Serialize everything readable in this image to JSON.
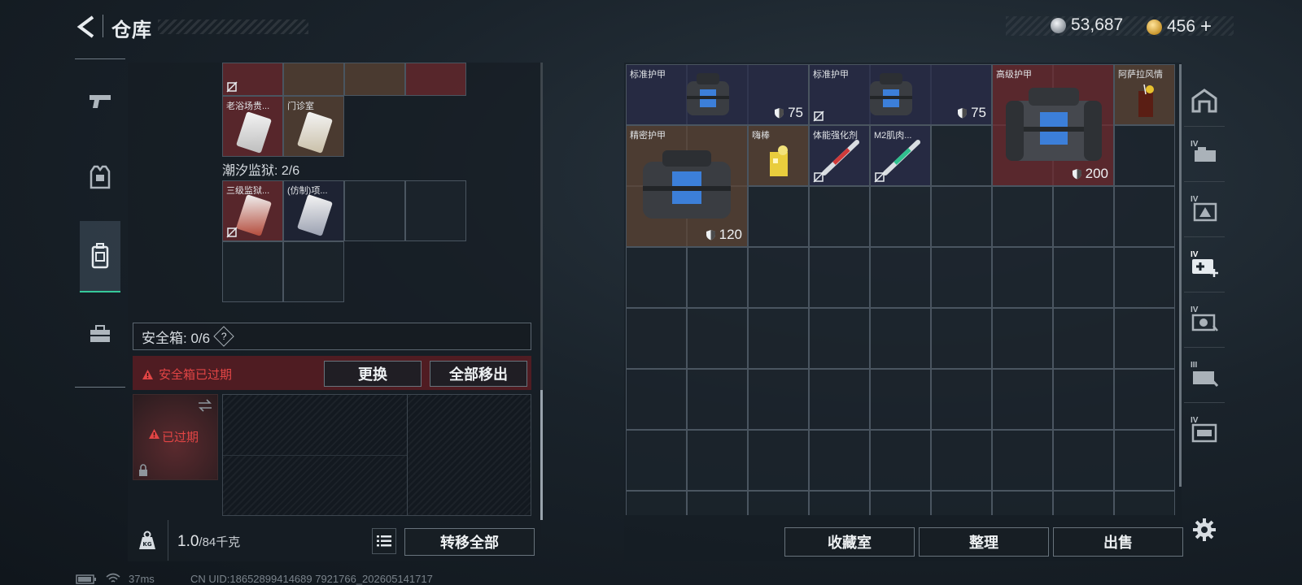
{
  "header": {
    "title": "仓库",
    "silver_amount": "53,687",
    "gold_amount": "456",
    "plus_label": "+"
  },
  "left_nav": {
    "items": [
      "weapon",
      "armor",
      "backpack",
      "toolbox"
    ],
    "active": "backpack"
  },
  "backpack": {
    "section_label": "潮汐监狱: 2/6",
    "top_items": [
      {
        "name": "老浴场贵...",
        "bg": "red"
      },
      {
        "name": "门诊室",
        "bg": "brown"
      }
    ],
    "prison_items": [
      {
        "name": "三级监狱...",
        "bg": "red"
      },
      {
        "name": "(仿制)项...",
        "bg": "dark"
      }
    ]
  },
  "safe_box": {
    "label": "安全箱: 0/6",
    "help_mark": "?",
    "warning": "安全箱已过期",
    "replace_label": "更换",
    "remove_all_label": "全部移出",
    "expired_label": "已过期"
  },
  "weight": {
    "current": "1.0",
    "max": "/84千克"
  },
  "transfer_all_label": "转移全部",
  "stash": {
    "items": [
      {
        "name": "标准护甲",
        "durability": "75",
        "bg": "navy"
      },
      {
        "name": "标准护甲",
        "durability": "75",
        "bg": "navy"
      },
      {
        "name": "高级护甲",
        "durability": "200",
        "bg": "red"
      },
      {
        "name": "阿萨拉风情",
        "bg": "brown"
      },
      {
        "name": "精密护甲",
        "durability": "120",
        "bg": "brown"
      },
      {
        "name": "嗨棒",
        "bg": "brown"
      },
      {
        "name": "体能强化剂",
        "bg": "navy"
      },
      {
        "name": "M2肌肉...",
        "bg": "navy"
      }
    ]
  },
  "bottom_buttons": {
    "collection": "收藏室",
    "organize": "整理",
    "sell": "出售"
  },
  "right_sidebar": {
    "tiers": [
      "",
      "IV",
      "IV",
      "IV",
      "IV",
      "III",
      "IV"
    ]
  },
  "status_bar": {
    "ping": "37ms",
    "uid": "CN UID:18652899414689 7921766_202605141717"
  },
  "colors": {
    "accent": "#36c99a",
    "danger": "#e24545"
  }
}
